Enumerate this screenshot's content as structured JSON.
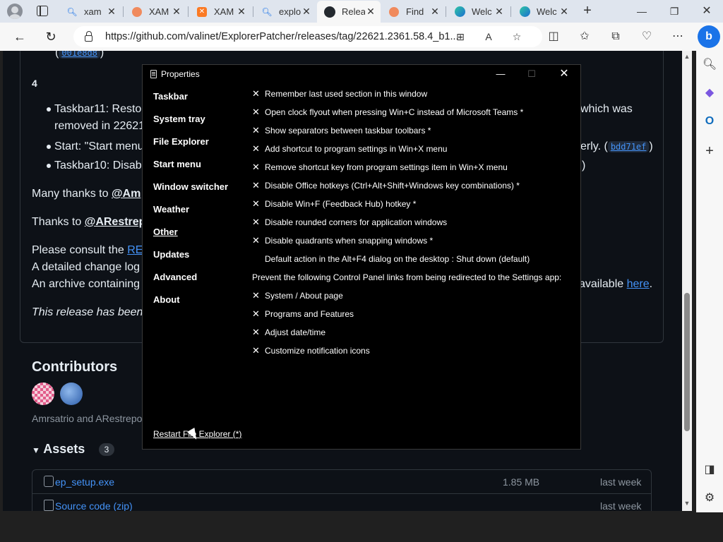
{
  "browser": {
    "tabs": [
      {
        "title": "xam",
        "icon": "search-icon"
      },
      {
        "title": "XAM",
        "icon": "xampp-icon"
      },
      {
        "title": "XAM",
        "icon": "xampp-icon"
      },
      {
        "title": "explo",
        "icon": "search-icon"
      },
      {
        "title": "Relea",
        "icon": "github-icon",
        "active": true
      },
      {
        "title": "Find",
        "icon": "xampp-icon"
      },
      {
        "title": "Welc",
        "icon": "edge-icon"
      },
      {
        "title": "Welc",
        "icon": "edge-icon"
      }
    ],
    "url": "https://github.com/valinet/ExplorerPatcher/releases/tag/22621.2361.58.4_b1..."
  },
  "release": {
    "top_sha": "001e8d8",
    "section_num": "4",
    "bullets": [
      {
        "line1": "Taskbar11: Restore",
        "line1_tail": "which was",
        "line2": "removed in 22621"
      },
      {
        "line1": "Start: \"Start menu",
        "tail": "erly. (",
        "sha": "bdd71ef",
        "close": ")"
      },
      {
        "line1": "Taskbar10: Disable",
        "tail": ")"
      }
    ],
    "thanks1_prefix": "Many thanks to",
    "thanks1_user": "@Am",
    "thanks2_prefix": "Thanks to",
    "thanks2_user": "@ARestrepo",
    "consult_prefix": "Please consult the",
    "consult_link": "REA",
    "changelog": "A detailed change log",
    "archive": "An archive containing",
    "archive_tail": "available",
    "archive_link": "here",
    "archive_dot": ".",
    "release_note": "This release has been p"
  },
  "contributors": {
    "heading": "Contributors",
    "names": "Amrsatrio and ARestrepo"
  },
  "assets": {
    "heading": "Assets",
    "count": "3",
    "items": [
      {
        "name": "ep_setup.exe",
        "size": "1.85 MB",
        "date": "last week"
      },
      {
        "name": "Source code",
        "ext": "(zip)",
        "date": "last week"
      }
    ]
  },
  "dialog": {
    "title": "Properties",
    "nav": [
      "Taskbar",
      "System tray",
      "File Explorer",
      "Start menu",
      "Window switcher",
      "Weather",
      "Other",
      "Updates",
      "Advanced",
      "About"
    ],
    "current_nav": "Other",
    "options": [
      {
        "checked": true,
        "label": "Remember last used section in this window"
      },
      {
        "checked": true,
        "label": "Open clock flyout when pressing Win+C instead of Microsoft Teams *"
      },
      {
        "checked": true,
        "label": "Show separators between taskbar toolbars *"
      },
      {
        "checked": true,
        "label": "Add shortcut to program settings in Win+X menu"
      },
      {
        "checked": true,
        "label": "Remove shortcut key from program settings item in Win+X menu"
      },
      {
        "checked": true,
        "label": "Disable Office hotkeys (Ctrl+Alt+Shift+Windows key combinations) *"
      },
      {
        "checked": true,
        "label": "Disable Win+F (Feedback Hub) hotkey *"
      },
      {
        "checked": true,
        "label": "Disable rounded corners for application windows"
      },
      {
        "checked": true,
        "label": "Disable quadrants when snapping windows *"
      },
      {
        "checked": false,
        "label": "Default action in the Alt+F4 dialog on the desktop : Shut down (default)"
      },
      {
        "header": true,
        "label": "Prevent the following Control Panel links from being redirected to the Settings app:"
      },
      {
        "checked": true,
        "label": "System / About page"
      },
      {
        "checked": true,
        "label": "Programs and Features"
      },
      {
        "checked": true,
        "label": "Adjust date/time"
      },
      {
        "checked": true,
        "label": "Customize notification icons"
      }
    ],
    "restart_label": "Restart File Explorer (*)"
  }
}
